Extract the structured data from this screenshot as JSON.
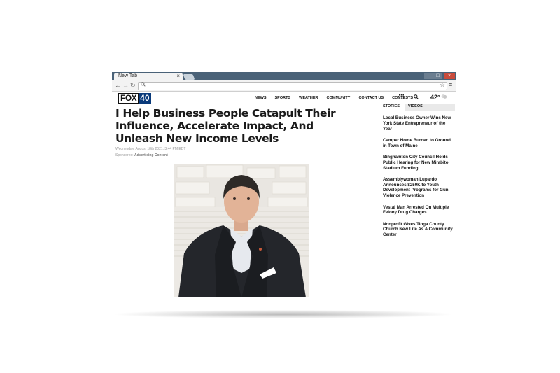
{
  "browser": {
    "tab_title": "New Tab",
    "tab_close": "×",
    "window_controls": {
      "minimize": "–",
      "maximize": "□",
      "close": "×"
    },
    "nav": {
      "back": "←",
      "forward": "→",
      "reload": "↻"
    },
    "address_placeholder": "",
    "icons": {
      "omnibox": "search-icon",
      "star": "star-icon",
      "menu": "menu-icon"
    }
  },
  "site": {
    "logo": {
      "fox": "FOX",
      "number": "40"
    },
    "nav_links": [
      "NEWS",
      "SPORTS",
      "WEATHER",
      "COMMUNITY",
      "CONTACT US",
      "CONTESTS"
    ],
    "temperature": "42°",
    "accent_color": "#0a3a7a"
  },
  "article": {
    "headline": "I Help Business People Catapult Their Influence, Accelerate Impact, And Unleash New Income Levels",
    "dateline": "Wednesday, August 18th 2021, 3:44 PM EDT",
    "sponsored_prefix": "Sponsored:",
    "sponsored_label": "Advertising Content"
  },
  "sidebar": {
    "tabs": [
      "STORIES",
      "VIDEOS"
    ],
    "stories": [
      "Local Business Owner Wins New York State Entrepreneur of the Year",
      "Camper Home Burned to Ground in Town of Maine",
      "Binghamton City Council Holds Public Hearing for New Mirabito Stadium Funding",
      "Assemblywoman Lupardo Announces $250K to Youth Development Programs for Gun Violence Prevention",
      "Vestal Man Arrested On Multiple Felony Drug Charges",
      "Nonprofit Gives Tioga County Church New Life As A Community Center"
    ]
  }
}
